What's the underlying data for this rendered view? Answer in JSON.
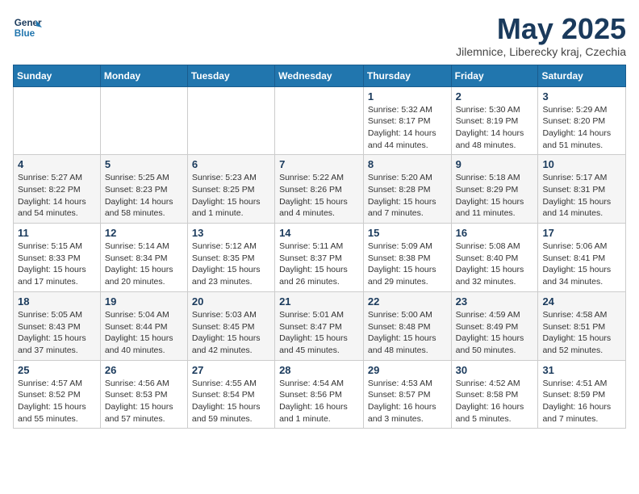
{
  "header": {
    "logo_line1": "General",
    "logo_line2": "Blue",
    "title": "May 2025",
    "subtitle": "Jilemnice, Liberecky kraj, Czechia"
  },
  "weekdays": [
    "Sunday",
    "Monday",
    "Tuesday",
    "Wednesday",
    "Thursday",
    "Friday",
    "Saturday"
  ],
  "weeks": [
    [
      {
        "day": "",
        "info": ""
      },
      {
        "day": "",
        "info": ""
      },
      {
        "day": "",
        "info": ""
      },
      {
        "day": "",
        "info": ""
      },
      {
        "day": "1",
        "info": "Sunrise: 5:32 AM\nSunset: 8:17 PM\nDaylight: 14 hours\nand 44 minutes."
      },
      {
        "day": "2",
        "info": "Sunrise: 5:30 AM\nSunset: 8:19 PM\nDaylight: 14 hours\nand 48 minutes."
      },
      {
        "day": "3",
        "info": "Sunrise: 5:29 AM\nSunset: 8:20 PM\nDaylight: 14 hours\nand 51 minutes."
      }
    ],
    [
      {
        "day": "4",
        "info": "Sunrise: 5:27 AM\nSunset: 8:22 PM\nDaylight: 14 hours\nand 54 minutes."
      },
      {
        "day": "5",
        "info": "Sunrise: 5:25 AM\nSunset: 8:23 PM\nDaylight: 14 hours\nand 58 minutes."
      },
      {
        "day": "6",
        "info": "Sunrise: 5:23 AM\nSunset: 8:25 PM\nDaylight: 15 hours\nand 1 minute."
      },
      {
        "day": "7",
        "info": "Sunrise: 5:22 AM\nSunset: 8:26 PM\nDaylight: 15 hours\nand 4 minutes."
      },
      {
        "day": "8",
        "info": "Sunrise: 5:20 AM\nSunset: 8:28 PM\nDaylight: 15 hours\nand 7 minutes."
      },
      {
        "day": "9",
        "info": "Sunrise: 5:18 AM\nSunset: 8:29 PM\nDaylight: 15 hours\nand 11 minutes."
      },
      {
        "day": "10",
        "info": "Sunrise: 5:17 AM\nSunset: 8:31 PM\nDaylight: 15 hours\nand 14 minutes."
      }
    ],
    [
      {
        "day": "11",
        "info": "Sunrise: 5:15 AM\nSunset: 8:33 PM\nDaylight: 15 hours\nand 17 minutes."
      },
      {
        "day": "12",
        "info": "Sunrise: 5:14 AM\nSunset: 8:34 PM\nDaylight: 15 hours\nand 20 minutes."
      },
      {
        "day": "13",
        "info": "Sunrise: 5:12 AM\nSunset: 8:35 PM\nDaylight: 15 hours\nand 23 minutes."
      },
      {
        "day": "14",
        "info": "Sunrise: 5:11 AM\nSunset: 8:37 PM\nDaylight: 15 hours\nand 26 minutes."
      },
      {
        "day": "15",
        "info": "Sunrise: 5:09 AM\nSunset: 8:38 PM\nDaylight: 15 hours\nand 29 minutes."
      },
      {
        "day": "16",
        "info": "Sunrise: 5:08 AM\nSunset: 8:40 PM\nDaylight: 15 hours\nand 32 minutes."
      },
      {
        "day": "17",
        "info": "Sunrise: 5:06 AM\nSunset: 8:41 PM\nDaylight: 15 hours\nand 34 minutes."
      }
    ],
    [
      {
        "day": "18",
        "info": "Sunrise: 5:05 AM\nSunset: 8:43 PM\nDaylight: 15 hours\nand 37 minutes."
      },
      {
        "day": "19",
        "info": "Sunrise: 5:04 AM\nSunset: 8:44 PM\nDaylight: 15 hours\nand 40 minutes."
      },
      {
        "day": "20",
        "info": "Sunrise: 5:03 AM\nSunset: 8:45 PM\nDaylight: 15 hours\nand 42 minutes."
      },
      {
        "day": "21",
        "info": "Sunrise: 5:01 AM\nSunset: 8:47 PM\nDaylight: 15 hours\nand 45 minutes."
      },
      {
        "day": "22",
        "info": "Sunrise: 5:00 AM\nSunset: 8:48 PM\nDaylight: 15 hours\nand 48 minutes."
      },
      {
        "day": "23",
        "info": "Sunrise: 4:59 AM\nSunset: 8:49 PM\nDaylight: 15 hours\nand 50 minutes."
      },
      {
        "day": "24",
        "info": "Sunrise: 4:58 AM\nSunset: 8:51 PM\nDaylight: 15 hours\nand 52 minutes."
      }
    ],
    [
      {
        "day": "25",
        "info": "Sunrise: 4:57 AM\nSunset: 8:52 PM\nDaylight: 15 hours\nand 55 minutes."
      },
      {
        "day": "26",
        "info": "Sunrise: 4:56 AM\nSunset: 8:53 PM\nDaylight: 15 hours\nand 57 minutes."
      },
      {
        "day": "27",
        "info": "Sunrise: 4:55 AM\nSunset: 8:54 PM\nDaylight: 15 hours\nand 59 minutes."
      },
      {
        "day": "28",
        "info": "Sunrise: 4:54 AM\nSunset: 8:56 PM\nDaylight: 16 hours\nand 1 minute."
      },
      {
        "day": "29",
        "info": "Sunrise: 4:53 AM\nSunset: 8:57 PM\nDaylight: 16 hours\nand 3 minutes."
      },
      {
        "day": "30",
        "info": "Sunrise: 4:52 AM\nSunset: 8:58 PM\nDaylight: 16 hours\nand 5 minutes."
      },
      {
        "day": "31",
        "info": "Sunrise: 4:51 AM\nSunset: 8:59 PM\nDaylight: 16 hours\nand 7 minutes."
      }
    ]
  ]
}
